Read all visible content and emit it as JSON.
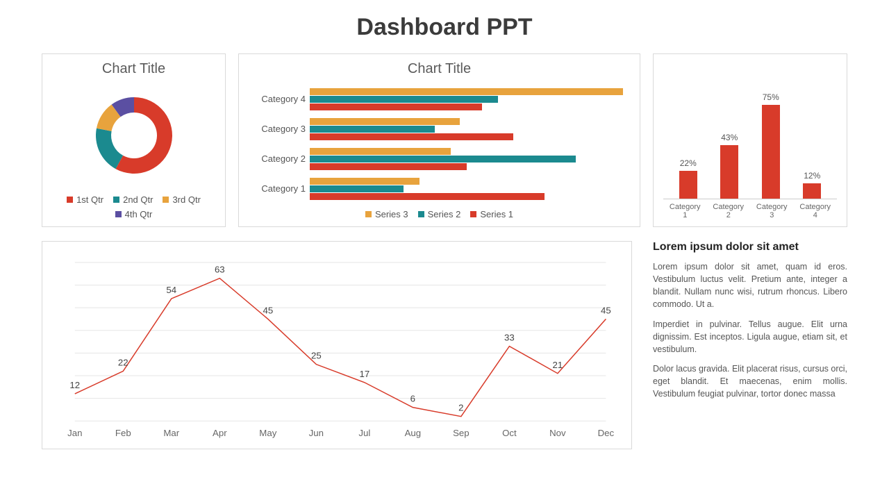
{
  "page_title": "Dashboard PPT",
  "colors": {
    "red": "#d83b2a",
    "teal": "#1b8a8f",
    "amber": "#e8a33d",
    "purple": "#5b4fa2"
  },
  "donut": {
    "title": "Chart Title",
    "legend": [
      "1st Qtr",
      "2nd Qtr",
      "3rd Qtr",
      "4th Qtr"
    ]
  },
  "hbar": {
    "title": "Chart Title",
    "legend": [
      "Series 3",
      "Series 2",
      "Series 1"
    ]
  },
  "colpct": {
    "categories": [
      "Category 1",
      "Category 2",
      "Category 3",
      "Category 4"
    ]
  },
  "text": {
    "heading": "Lorem ipsum dolor sit amet",
    "p1": "Lorem ipsum dolor sit amet, quam id eros. Vestibulum luctus velit. Pretium ante, integer a blandit. Nullam nunc wisi, rutrum rhoncus. Libero commodo. Ut a.",
    "p2": "Imperdiet in pulvinar. Tellus augue. Elit urna dignissim. Est inceptos. Ligula augue, etiam sit, et vestibulum.",
    "p3": "Dolor lacus gravida. Elit placerat risus, cursus orci, eget blandit. Et maecenas, enim mollis. Vestibulum feugiat pulvinar, tortor donec massa"
  },
  "chart_data": [
    {
      "type": "pie",
      "title": "Chart Title",
      "subtype": "donut",
      "categories": [
        "1st Qtr",
        "2nd Qtr",
        "3rd Qtr",
        "4th Qtr"
      ],
      "values": [
        58,
        20,
        12,
        10
      ],
      "colors": [
        "#d83b2a",
        "#1b8a8f",
        "#e8a33d",
        "#5b4fa2"
      ]
    },
    {
      "type": "bar",
      "orientation": "horizontal",
      "title": "Chart Title",
      "categories": [
        "Category 1",
        "Category 2",
        "Category 3",
        "Category 4"
      ],
      "series": [
        {
          "name": "Series 3",
          "color": "#e8a33d",
          "values": [
            35,
            45,
            48,
            100
          ]
        },
        {
          "name": "Series 2",
          "color": "#1b8a8f",
          "values": [
            30,
            85,
            40,
            60
          ]
        },
        {
          "name": "Series 1",
          "color": "#d83b2a",
          "values": [
            75,
            50,
            65,
            55
          ]
        }
      ],
      "xlim": [
        0,
        100
      ]
    },
    {
      "type": "bar",
      "title": "",
      "categories": [
        "Category 1",
        "Category 2",
        "Category 3",
        "Category 4"
      ],
      "values": [
        22,
        43,
        75,
        12
      ],
      "value_format": "percent",
      "color": "#d83b2a",
      "ylim": [
        0,
        100
      ]
    },
    {
      "type": "line",
      "title": "",
      "x": [
        "Jan",
        "Feb",
        "Mar",
        "Apr",
        "May",
        "Jun",
        "Jul",
        "Aug",
        "Sep",
        "Oct",
        "Nov",
        "Dec"
      ],
      "values": [
        12,
        22,
        54,
        63,
        45,
        25,
        17,
        6,
        2,
        33,
        21,
        45
      ],
      "color": "#d83b2a",
      "ylim": [
        0,
        70
      ]
    }
  ]
}
